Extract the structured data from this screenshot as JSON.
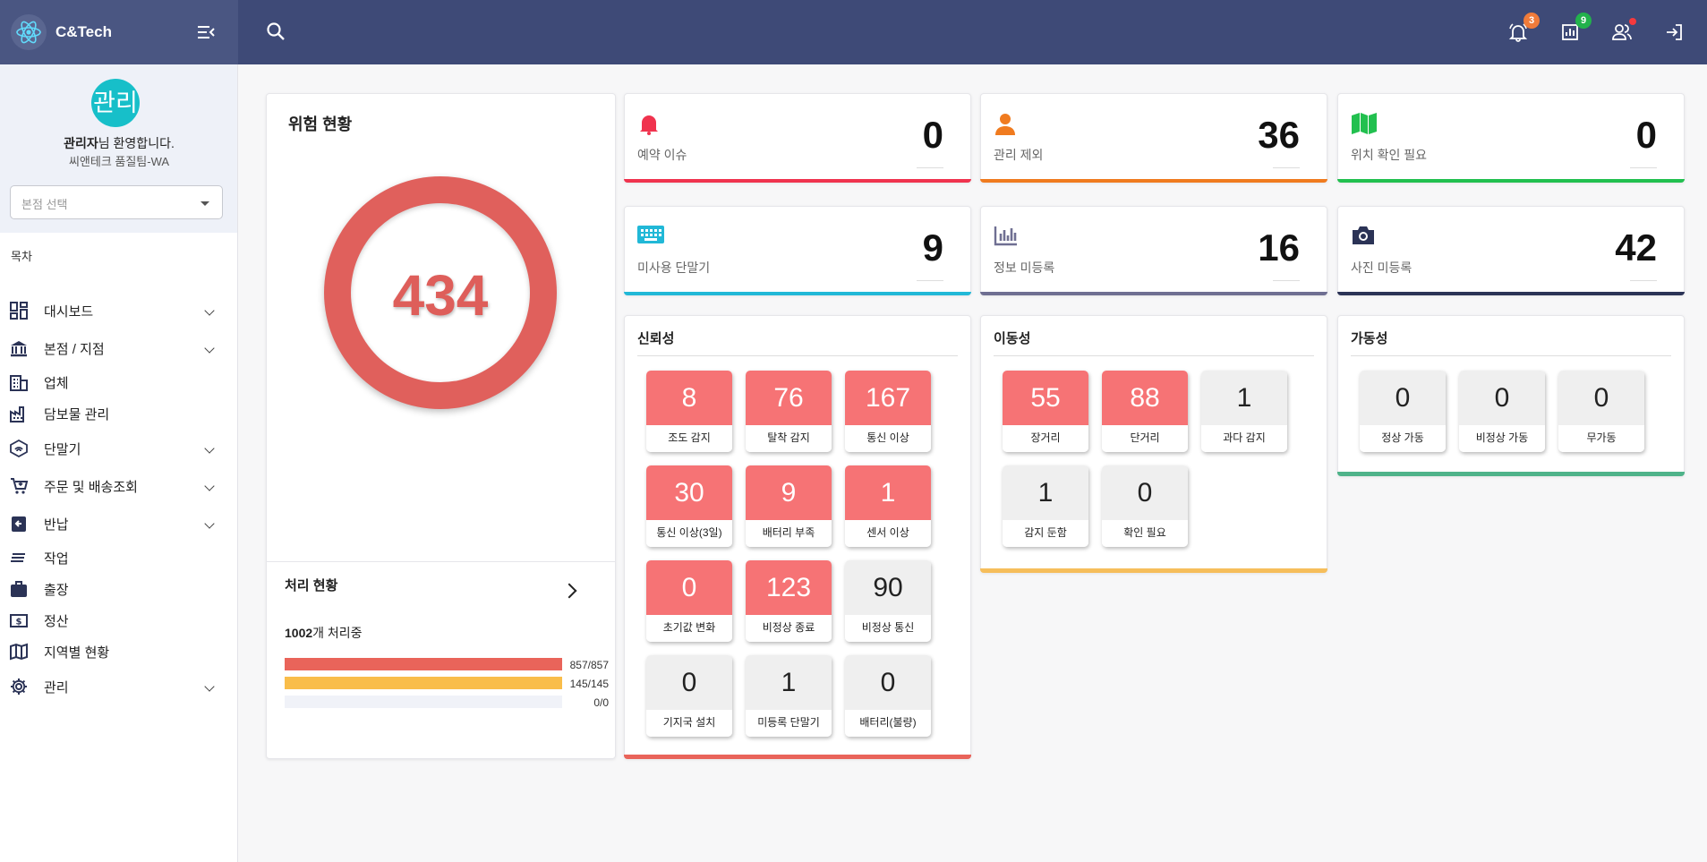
{
  "brand": {
    "name": "C&Tech"
  },
  "header": {
    "alerts_badge": "3",
    "reports_badge": "9"
  },
  "sidebar": {
    "avatar_text": "관리",
    "welcome_name": "관리자",
    "welcome_suffix": "님 환영합니다.",
    "team": "씨앤테크 품질팀-WA",
    "branch_placeholder": "본점 선택",
    "toc_label": "목차",
    "items": [
      {
        "label": "대시보드",
        "icon": "dashboard-icon",
        "expandable": true
      },
      {
        "label": "본점 / 지점",
        "icon": "bank-icon",
        "expandable": true
      },
      {
        "label": "업체",
        "icon": "building-icon",
        "expandable": false
      },
      {
        "label": "담보물 관리",
        "icon": "factory-icon",
        "expandable": false
      },
      {
        "label": "단말기",
        "icon": "router-icon",
        "expandable": true
      },
      {
        "label": "주문 및 배송조회",
        "icon": "cart-icon",
        "expandable": true
      },
      {
        "label": "반납",
        "icon": "return-icon",
        "expandable": true
      },
      {
        "label": "작업",
        "icon": "task-icon",
        "expandable": false
      },
      {
        "label": "출장",
        "icon": "briefcase-icon",
        "expandable": false
      },
      {
        "label": "정산",
        "icon": "money-icon",
        "expandable": false
      },
      {
        "label": "지역별 현황",
        "icon": "map-icon",
        "expandable": false
      },
      {
        "label": "관리",
        "icon": "gear-icon",
        "expandable": true
      }
    ]
  },
  "risk": {
    "title": "위험 현황",
    "total": "434",
    "process": {
      "title": "처리 현황",
      "count": "1002",
      "count_suffix": "개 처리중",
      "bars": [
        {
          "text": "857/857",
          "fill": 1.0,
          "color": "#e9645a"
        },
        {
          "text": "145/145",
          "fill": 1.0,
          "color": "#f9bd4a"
        },
        {
          "text": "0/0",
          "fill": 0.0,
          "color": "#cccccc"
        }
      ]
    }
  },
  "stats": [
    {
      "label": "예약 이슈",
      "value": "0",
      "icon": "bell-icon",
      "color": "#f0334e"
    },
    {
      "label": "관리 제외",
      "value": "36",
      "icon": "person-icon",
      "color": "#f07b1f"
    },
    {
      "label": "위치 확인 필요",
      "value": "0",
      "icon": "map-icon",
      "color": "#22c04f"
    },
    {
      "label": "미사용 단말기",
      "value": "9",
      "icon": "keyboard-icon",
      "color": "#21b8d7"
    },
    {
      "label": "정보 미등록",
      "value": "16",
      "icon": "chart-icon",
      "color": "#6f6f92"
    },
    {
      "label": "사진 미등록",
      "value": "42",
      "icon": "camera-icon",
      "color": "#2b3356"
    }
  ],
  "groups": {
    "reliability": {
      "title": "신뢰성",
      "tiles": [
        {
          "value": "8",
          "label": "조도 감지",
          "alert": true
        },
        {
          "value": "76",
          "label": "탈착 감지",
          "alert": true
        },
        {
          "value": "167",
          "label": "통신 이상",
          "alert": true
        },
        {
          "value": "30",
          "label": "통신 이상(3일)",
          "alert": true
        },
        {
          "value": "9",
          "label": "배터리 부족",
          "alert": true
        },
        {
          "value": "1",
          "label": "센서 이상",
          "alert": true
        },
        {
          "value": "0",
          "label": "초기값 변화",
          "alert": true
        },
        {
          "value": "123",
          "label": "비정상 종료",
          "alert": true
        },
        {
          "value": "90",
          "label": "비정상 통신",
          "alert": false
        },
        {
          "value": "0",
          "label": "기지국 설치",
          "alert": false
        },
        {
          "value": "1",
          "label": "미등록 단말기",
          "alert": false
        },
        {
          "value": "0",
          "label": "배터리(불량)",
          "alert": false
        }
      ]
    },
    "mobility": {
      "title": "이동성",
      "tiles": [
        {
          "value": "55",
          "label": "장거리",
          "alert": true
        },
        {
          "value": "88",
          "label": "단거리",
          "alert": true
        },
        {
          "value": "1",
          "label": "과다 감지",
          "alert": false
        },
        {
          "value": "1",
          "label": "감지 둔함",
          "alert": false
        },
        {
          "value": "0",
          "label": "확인 필요",
          "alert": false
        }
      ]
    },
    "operability": {
      "title": "가동성",
      "tiles": [
        {
          "value": "0",
          "label": "정상 가동",
          "alert": false
        },
        {
          "value": "0",
          "label": "비정상 가동",
          "alert": false
        },
        {
          "value": "0",
          "label": "무가동",
          "alert": false
        }
      ]
    }
  }
}
